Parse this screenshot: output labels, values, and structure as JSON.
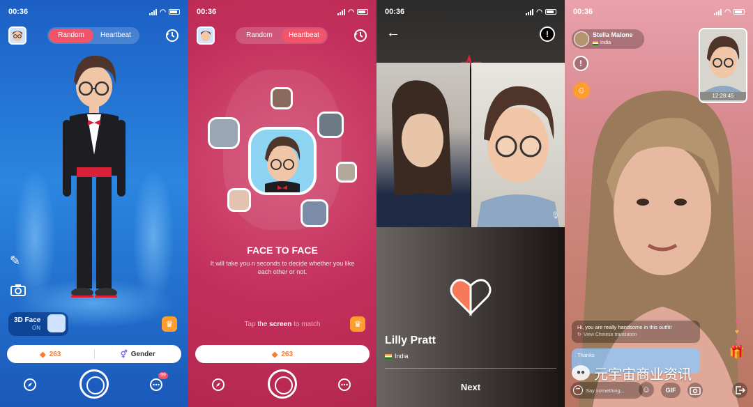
{
  "status": {
    "time": "00:36"
  },
  "panel1": {
    "tabs": [
      "Random",
      "Heartbeat"
    ],
    "active_tab": 0,
    "face_chip": {
      "title": "3D Face",
      "state": "ON"
    },
    "gems": "263",
    "gender_label": "Gender",
    "badge_count": "99"
  },
  "panel2": {
    "tabs": [
      "Random",
      "Heartbeat"
    ],
    "active_tab": 1,
    "title": "FACE TO FACE",
    "subtitle": "It will take you n seconds to decide whether you like each other or not.",
    "tap_hint_pre": "Tap ",
    "tap_hint_the": "the ",
    "tap_hint_screen": "screen",
    "tap_hint_post": " to match",
    "gems": "263"
  },
  "panel3": {
    "name": "Lilly Pratt",
    "country": "India",
    "next_label": "Next"
  },
  "panel4": {
    "user_name": "Stella Malone",
    "user_country": "India",
    "timer": "12:28:45",
    "message": "Hi, you are really handsome in this outfit!",
    "translate_hint": "View Chinese translation",
    "reply": "Thanks",
    "input_placeholder": "Say something...",
    "gif_label": "GIF"
  },
  "watermark": {
    "text": "元宇宙商业资讯"
  },
  "colors": {
    "accent": "#f2556a",
    "gem": "#ff7a2e",
    "panel1_bg": "#2b86e0",
    "panel2_bg": "#c22e5b"
  }
}
